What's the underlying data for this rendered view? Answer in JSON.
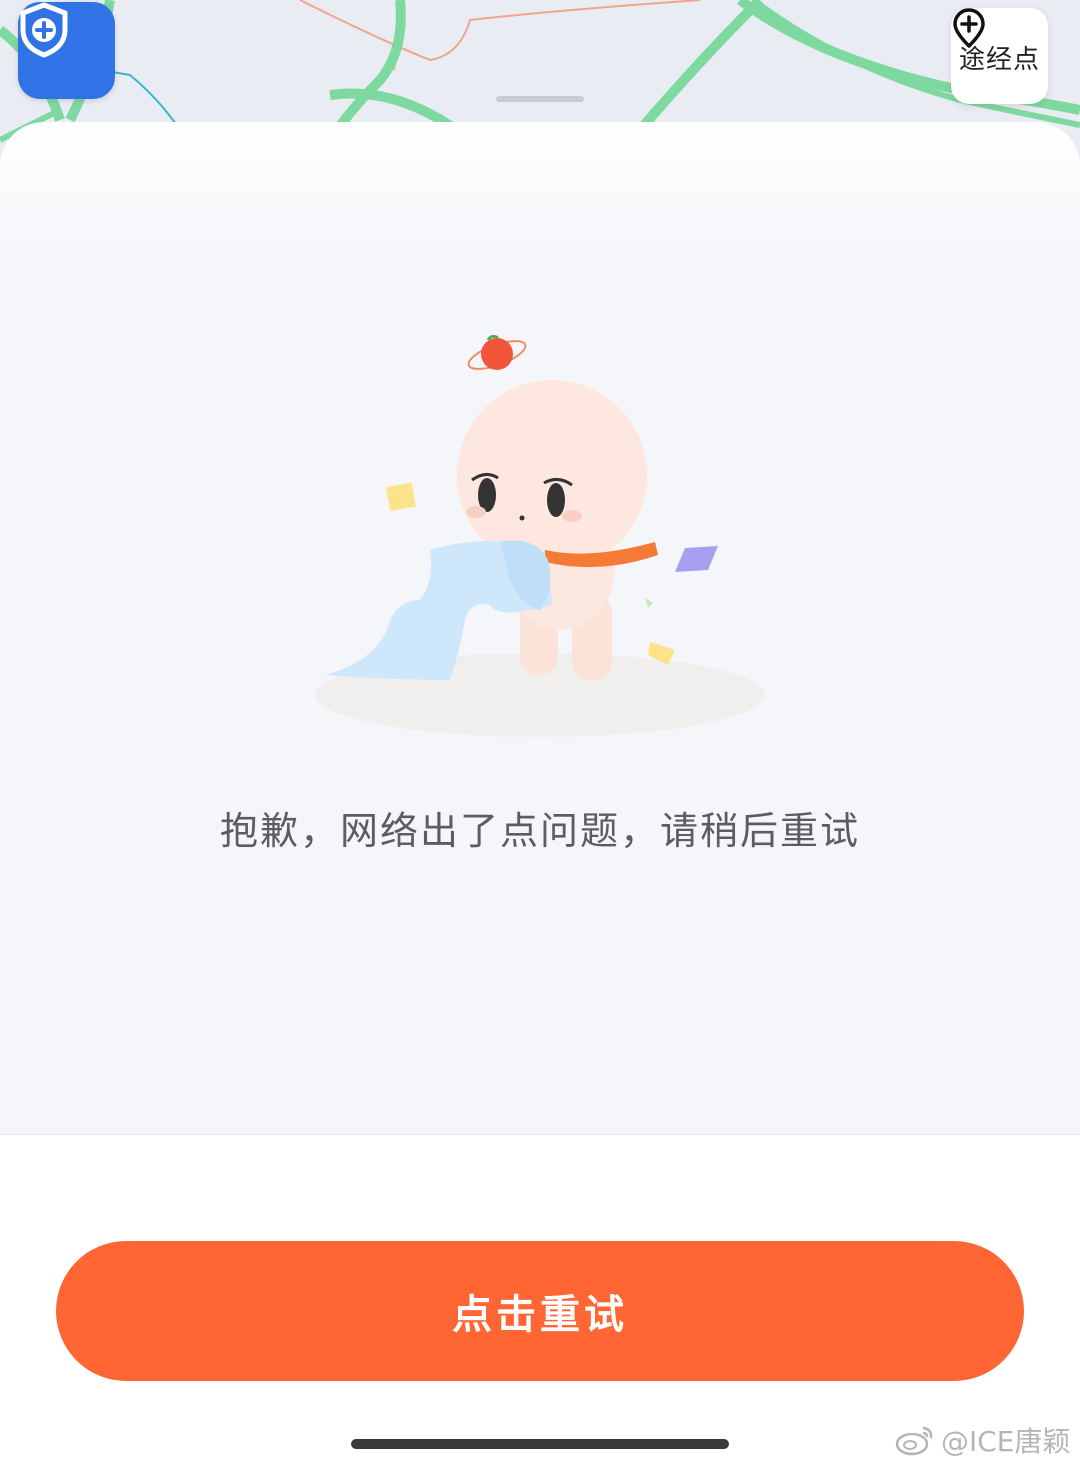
{
  "map": {
    "safety_icon": "shield-plus-icon",
    "waypoint": {
      "icon": "plus-pin-icon",
      "label": "途经点"
    },
    "colors": {
      "road_green": "#7ed9a0",
      "road_yellow": "#f2c94c",
      "road_orange": "#f08b6a",
      "road_teal": "#35b6c9"
    }
  },
  "sheet": {
    "illustration": "sad-mascot-illustration",
    "error_message": "抱歉，网络出了点问题，请稍后重试"
  },
  "footer": {
    "retry_label": "点击重试",
    "accent": "#ff6633"
  },
  "watermark": {
    "icon": "weibo-icon",
    "text": "@ICE唐颖"
  }
}
